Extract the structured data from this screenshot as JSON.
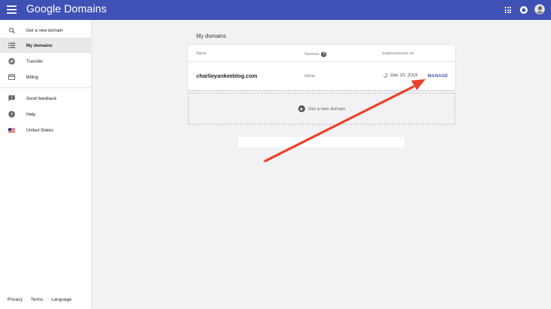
{
  "header": {
    "brand": "Google Domains"
  },
  "sidebar": {
    "items": [
      {
        "label": "Get a new domain",
        "icon": "search-icon"
      },
      {
        "label": "My domains",
        "icon": "list-icon",
        "active": true
      },
      {
        "label": "Transfer",
        "icon": "transfer-icon"
      },
      {
        "label": "Billing",
        "icon": "credit-card-icon"
      },
      {
        "label": "Send feedback",
        "icon": "feedback-icon"
      },
      {
        "label": "Help",
        "icon": "help-icon"
      },
      {
        "label": "United States",
        "icon": "us-flag-icon"
      }
    ],
    "footer": {
      "privacy": "Privacy",
      "terms": "Terms",
      "language": "Language"
    }
  },
  "main": {
    "title": "My domains",
    "table": {
      "headers": {
        "name": "Name",
        "services": "Services",
        "expires": "Expires/renews on"
      },
      "rows": [
        {
          "domain": "charlieyankeeblog.com",
          "services": "None",
          "expires": "Dec 20, 2019",
          "action": "MANAGE"
        }
      ]
    },
    "add_domain": "Get a new domain"
  },
  "colors": {
    "appbar": "#3f51b5",
    "accent": "#3f51b5",
    "annotation_arrow": "#e8442e"
  }
}
